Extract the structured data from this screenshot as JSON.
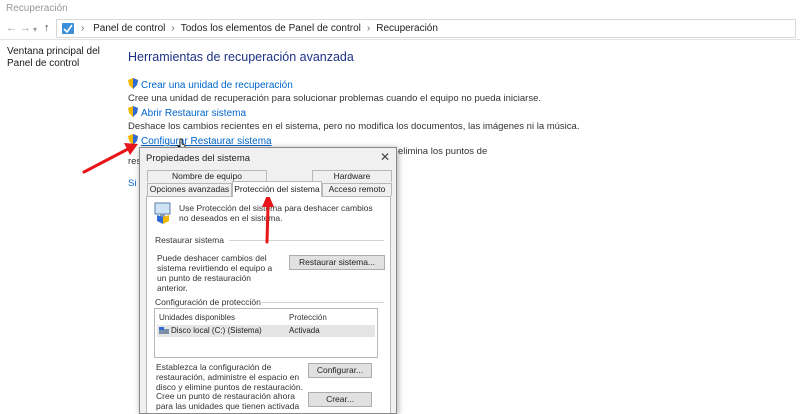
{
  "window": {
    "title": "Recuperación"
  },
  "nav": {
    "back_icon": "back-arrow-icon",
    "forward_icon": "forward-arrow-icon",
    "up_icon": "up-arrow-icon"
  },
  "breadcrumbs": [
    "Panel de control",
    "Todos los elementos de Panel de control",
    "Recuperación"
  ],
  "sidebar": {
    "link": "Ventana principal del Panel de control"
  },
  "main": {
    "heading": "Herramientas de recuperación avanzada",
    "items": [
      {
        "link": "Crear una unidad de recuperación",
        "desc": "Cree una unidad de recuperación para solucionar problemas cuando el equipo no pueda iniciarse."
      },
      {
        "link": "Abrir Restaurar sistema",
        "desc": "Deshace los cambios recientes en el sistema, pero no modifica los documentos, las imágenes ni la música."
      },
      {
        "link": "Configurar Restaurar sistema",
        "desc": ""
      }
    ],
    "partial_right": "elimina los puntos de",
    "partial_left_1": "res",
    "partial_left_2": "Si t"
  },
  "dialog": {
    "title": "Propiedades del sistema",
    "close": "✕",
    "tabs_row1": [
      "Nombre de equipo",
      "Hardware"
    ],
    "tabs_row2": [
      "Opciones avanzadas",
      "Protección del sistema",
      "Acceso remoto"
    ],
    "active_tab": "Protección del sistema",
    "info_text": "Use Protección del sistema para deshacer cambios no deseados en el sistema.",
    "restore_group": "Restaurar sistema",
    "restore_text": "Puede deshacer cambios del sistema revirtiendo el equipo a un punto de restauración anterior.",
    "restore_button": "Restaurar sistema...",
    "config_group": "Configuración de protección",
    "list_headers": [
      "Unidades disponibles",
      "Protección"
    ],
    "list_rows": [
      {
        "drive": "Disco local (C:) (Sistema)",
        "protection": "Activada"
      }
    ],
    "configure_text": "Establezca la configuración de restauración, administre el espacio en disco y elimine puntos de restauración.",
    "configure_button": "Configurar...",
    "create_text": "Cree un punto de restauración ahora para las unidades que tienen activada la protección del sistema.",
    "create_button": "Crear..."
  },
  "colors": {
    "link": "#0066cc",
    "heading": "#1e3287",
    "annotation_arrow": "#e8161b"
  }
}
